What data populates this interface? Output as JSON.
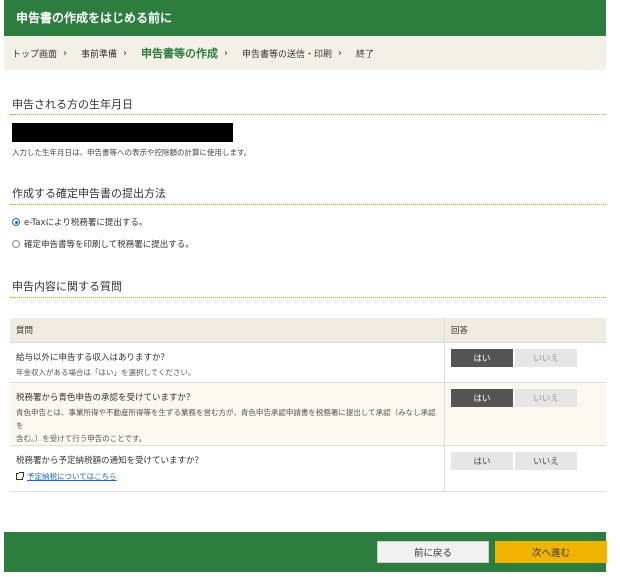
{
  "header": {
    "title": "申告書の作成をはじめる前に"
  },
  "breadcrumb": {
    "items": [
      "トップ画面",
      "事前準備",
      "申告書等の作成",
      "申告書等の送信・印刷",
      "終了"
    ],
    "separator": "›"
  },
  "birth": {
    "title": "申告される方の生年月日",
    "hint": "入力した生年月日は、申告書等への表示や控除額の計算に使用します。"
  },
  "submission": {
    "title": "作成する確定申告書の提出方法",
    "options": [
      "e-Taxにより税務署に提出する。",
      "確定申告書等を印刷して税務署に提出する。"
    ],
    "selected_index": 0
  },
  "questions": {
    "title": "申告内容に関する質問",
    "header_question": "質問",
    "header_answer": "回答",
    "yes_label": "はい",
    "no_label": "いいえ",
    "rows": [
      {
        "q": "給与以外に申告する収入はありますか？",
        "sub": "年金収入がある場合は「はい」を選択してください。",
        "answer": "yes"
      },
      {
        "q": "税務署から青色申告の承認を受けていますか？",
        "sub1": "青色申告とは、事業所得や不動産所得等を生ずる業務を営む方が、青色申告承認申請書を税務署に提出して承認（みなし承認を",
        "sub2": "含む。）を受けて行う申告のことです。",
        "answer": "yes"
      },
      {
        "q": "税務署から予定納税額の通知を受けていますか？",
        "link": "予定納税についてはこちら",
        "answer": "none"
      }
    ]
  },
  "footer": {
    "back_label": "前に戻る",
    "next_label": "次へ進む"
  },
  "colors": {
    "brand_green": "#2d7d3f",
    "accent_yellow": "#f0b400"
  }
}
